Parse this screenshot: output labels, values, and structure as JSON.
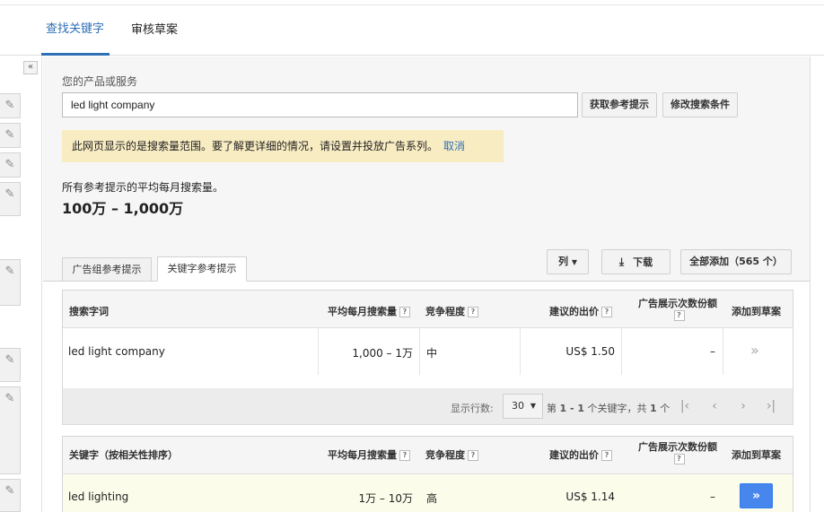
{
  "top_tabs": [
    "查找关键字",
    "审核草案"
  ],
  "collapse_glyph": "«",
  "product_label": "您的产品或服务",
  "search_value": "led light company",
  "buttons": {
    "get_ideas": "获取参考提示",
    "modify": "修改搜索条件",
    "columns": "列",
    "download": "下载",
    "add_all": "全部添加（565 个）"
  },
  "notice": {
    "text": "此网页显示的是搜索量范围。要了解更详细的情况，请设置并投放广告系列。",
    "link": "取消"
  },
  "avg": {
    "label": "所有参考提示的平均每月搜索量。",
    "value": "100万 – 1,000万"
  },
  "panel_tabs": [
    "广告组参考提示",
    "关键字参考提示"
  ],
  "table1": {
    "headers": [
      "搜索字词",
      "平均每月搜索量",
      "竞争程度",
      "建议的出价",
      "广告展示次数份额",
      "添加到草案"
    ],
    "row": {
      "keyword": "led light company",
      "volume": "1,000 – 1万",
      "competition": "中",
      "bid": "US$ 1.50",
      "share": "–",
      "add": "»"
    }
  },
  "pager": {
    "rows_label": "显示行数:",
    "rows_value": "30",
    "summary_pre": "第",
    "range": "1 - 1",
    "summary_mid": "个关键字，共",
    "total": "1",
    "summary_post": "个"
  },
  "table2": {
    "headers": [
      "关键字（按相关性排序）",
      "平均每月搜索量",
      "竞争程度",
      "建议的出价",
      "广告展示次数份额",
      "添加到草案"
    ],
    "row": {
      "keyword": "led lighting",
      "volume": "1万 – 10万",
      "competition": "高",
      "bid": "US$ 1.14",
      "share": "–",
      "add": "»"
    }
  },
  "colors": {
    "accent": "#2f6fb6",
    "notice_bg": "#f8ecc2",
    "add_button": "#4787ed"
  }
}
